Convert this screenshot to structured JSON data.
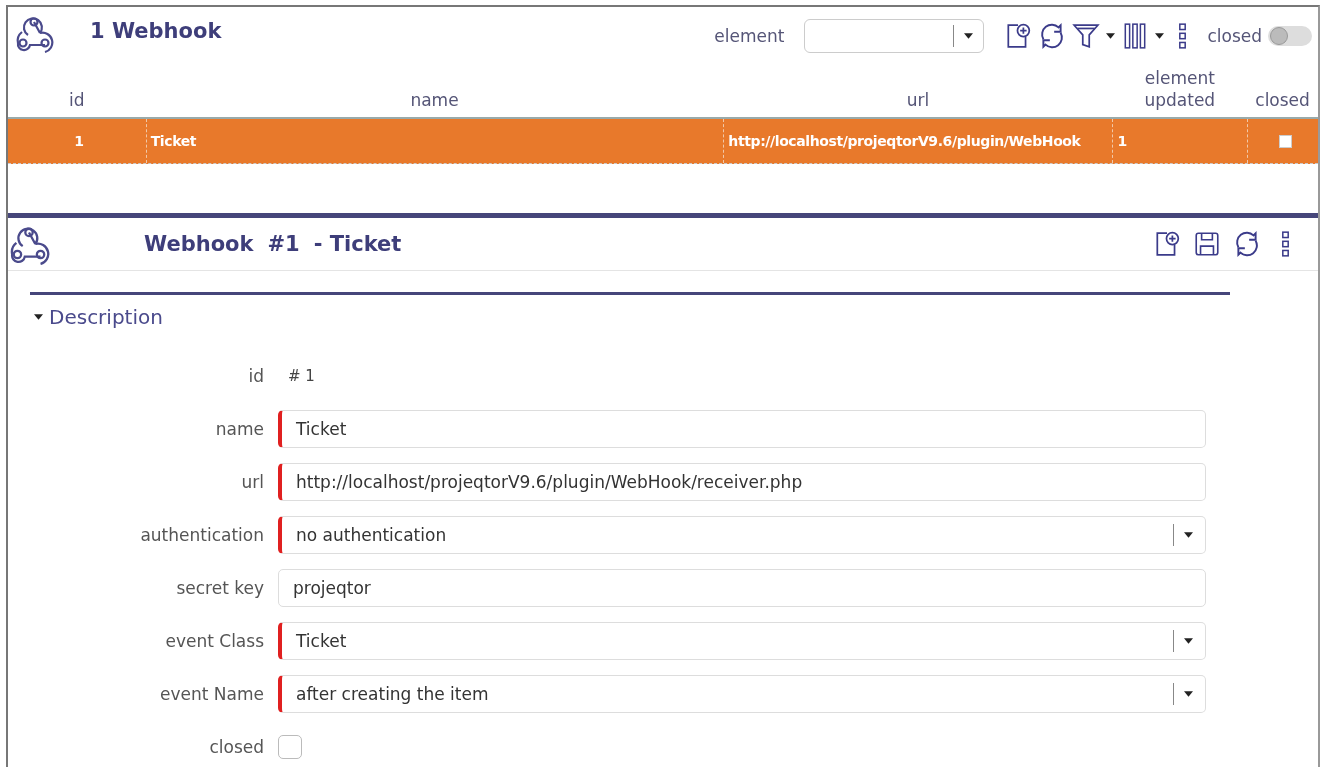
{
  "list": {
    "title": "1 Webhook",
    "filter_label": "element",
    "closed_label": "closed",
    "show_closed": false,
    "columns": [
      {
        "label": "id"
      },
      {
        "label": "name"
      },
      {
        "label": "url"
      },
      {
        "label": "element updated"
      },
      {
        "label": "closed"
      }
    ],
    "rows": [
      {
        "selected": true,
        "id": "1",
        "name": "Ticket",
        "url": "http://localhost/projeqtorV9.6/plugin/WebHook",
        "element_updated": "1",
        "closed": false
      }
    ]
  },
  "detail": {
    "title": "Webhook",
    "number": "#1",
    "subtitle": "- Ticket",
    "section": {
      "label": "Description",
      "expanded": true
    },
    "fields": [
      {
        "kind": "readonly",
        "label": "id",
        "value": "#  1"
      },
      {
        "kind": "text",
        "label": "name",
        "value": "Ticket",
        "required": true
      },
      {
        "kind": "text",
        "label": "url",
        "value": "http://localhost/projeqtorV9.6/plugin/WebHook/receiver.php",
        "required": true
      },
      {
        "kind": "select",
        "label": "authentication",
        "value": "no authentication",
        "required": true
      },
      {
        "kind": "text",
        "label": "secret key",
        "value": "projeqtor",
        "required": false
      },
      {
        "kind": "select",
        "label": "event Class",
        "value": "Ticket",
        "required": true
      },
      {
        "kind": "select",
        "label": "event Name",
        "value": "after creating the item",
        "required": true
      },
      {
        "kind": "checkbox",
        "label": "closed",
        "checked": false
      }
    ]
  }
}
